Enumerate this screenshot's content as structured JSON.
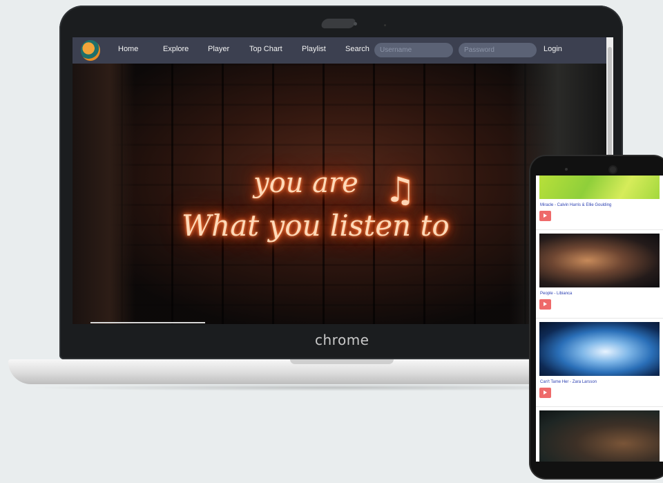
{
  "laptop": {
    "brand_label": "chrome",
    "nav": {
      "links": [
        "Home",
        "Explore",
        "Player",
        "Top Chart",
        "Playlist",
        "Search"
      ],
      "username_placeholder": "Username",
      "password_placeholder": "Password",
      "login_label": "Login"
    },
    "hero": {
      "line1": "you are",
      "line2": "What you listen to",
      "note_glyph": "♫"
    }
  },
  "phone": {
    "cards": [
      {
        "title": "Miracle - Calvin Harris & Ellie Goulding"
      },
      {
        "title": "People - Libianca"
      },
      {
        "title": "Can't Tame Her - Zara Larsson"
      }
    ]
  },
  "colors": {
    "navbar": "#3c4050",
    "play_button": "#ee6a6a",
    "song_title": "#2a3eb1",
    "background": "#e9edee"
  }
}
